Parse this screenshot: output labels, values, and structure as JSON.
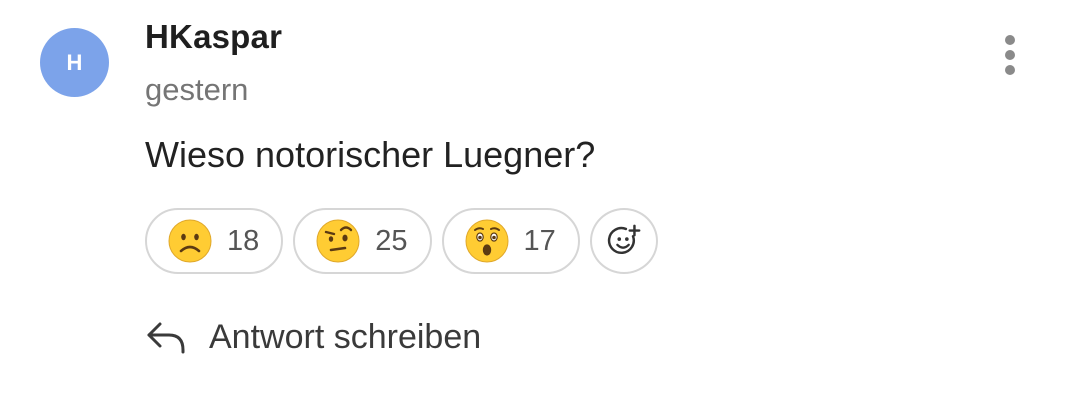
{
  "colors": {
    "avatar_bg": "#7ca3ea",
    "emoji_face": "#ffcc33"
  },
  "comment": {
    "avatar_letter": "H",
    "username": "HKaspar",
    "timestamp": "gestern",
    "text": "Wieso notorischer Luegner?",
    "more_icon": "more-vertical-icon"
  },
  "reactions": [
    {
      "icon": "slightly-frowning-face-emoji",
      "count": "18"
    },
    {
      "icon": "face-with-raised-eyebrow-emoji",
      "count": "25"
    },
    {
      "icon": "astonished-face-emoji",
      "count": "17"
    }
  ],
  "add_reaction_icon": "add-reaction-icon",
  "reply": {
    "icon": "reply-arrow-icon",
    "label": "Antwort schreiben"
  }
}
